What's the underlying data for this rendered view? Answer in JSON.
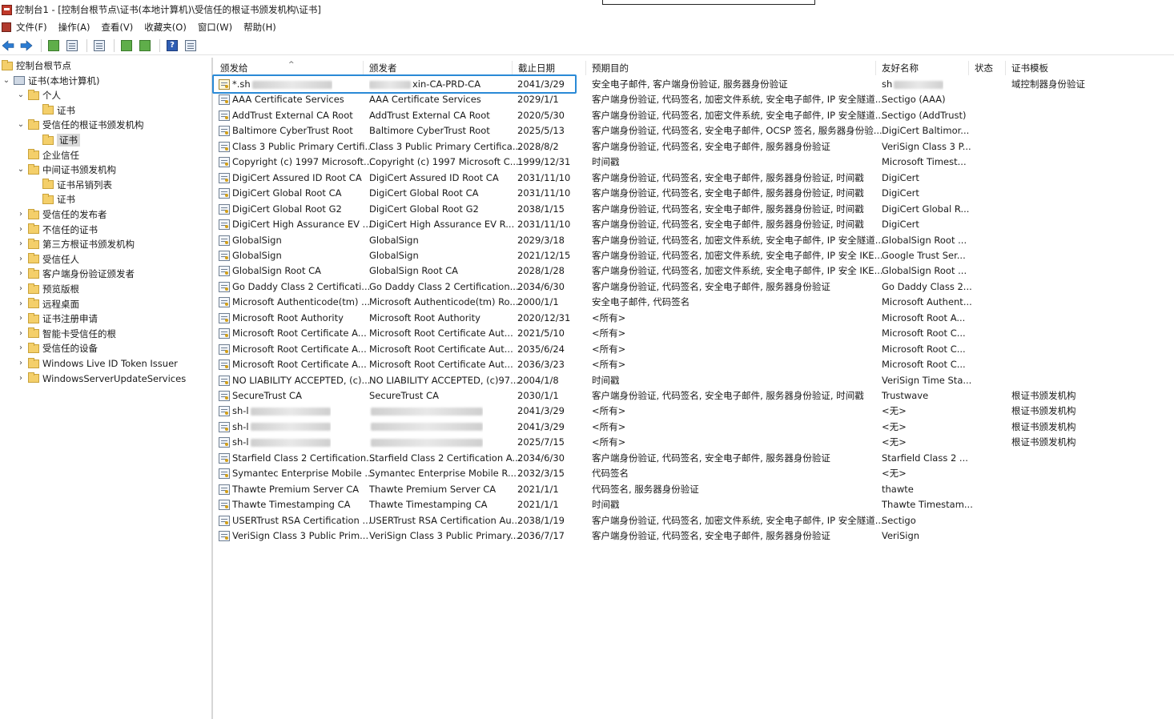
{
  "window": {
    "title": "控制台1 - [控制台根节点\\证书(本地计算机)\\受信任的根证书颁发机构\\证书]"
  },
  "menu": [
    "文件(F)",
    "操作(A)",
    "查看(V)",
    "收藏夹(O)",
    "窗口(W)",
    "帮助(H)"
  ],
  "toolbar": {
    "icons": [
      "back-icon",
      "forward-icon",
      "up-folder-icon",
      "show-tree-icon",
      "clipboard-icon",
      "refresh-icon",
      "export-icon",
      "help-icon",
      "properties-icon"
    ]
  },
  "tree": [
    {
      "label": "控制台根节点",
      "level": 0,
      "icon": "folder",
      "arrow": ""
    },
    {
      "label": "证书(本地计算机)",
      "level": 0,
      "icon": "pc",
      "arrow": "⌄"
    },
    {
      "label": "个人",
      "level": 1,
      "icon": "folder",
      "arrow": "⌄"
    },
    {
      "label": "证书",
      "level": 2,
      "icon": "folder",
      "arrow": ""
    },
    {
      "label": "受信任的根证书颁发机构",
      "level": 1,
      "icon": "folder",
      "arrow": "⌄"
    },
    {
      "label": "证书",
      "level": 2,
      "icon": "folder",
      "arrow": "",
      "selected": true
    },
    {
      "label": "企业信任",
      "level": 1,
      "icon": "folder",
      "arrow": ""
    },
    {
      "label": "中间证书颁发机构",
      "level": 1,
      "icon": "folder",
      "arrow": "⌄"
    },
    {
      "label": "证书吊销列表",
      "level": 2,
      "icon": "folder",
      "arrow": ""
    },
    {
      "label": "证书",
      "level": 2,
      "icon": "folder",
      "arrow": ""
    },
    {
      "label": "受信任的发布者",
      "level": 1,
      "icon": "folder",
      "arrow": "›"
    },
    {
      "label": "不信任的证书",
      "level": 1,
      "icon": "folder",
      "arrow": "›"
    },
    {
      "label": "第三方根证书颁发机构",
      "level": 1,
      "icon": "folder",
      "arrow": "›"
    },
    {
      "label": "受信任人",
      "level": 1,
      "icon": "folder",
      "arrow": "›"
    },
    {
      "label": "客户端身份验证颁发者",
      "level": 1,
      "icon": "folder",
      "arrow": "›"
    },
    {
      "label": "预览版根",
      "level": 1,
      "icon": "folder",
      "arrow": "›"
    },
    {
      "label": "远程桌面",
      "level": 1,
      "icon": "folder",
      "arrow": "›"
    },
    {
      "label": "证书注册申请",
      "level": 1,
      "icon": "folder",
      "arrow": "›"
    },
    {
      "label": "智能卡受信任的根",
      "level": 1,
      "icon": "folder",
      "arrow": "›"
    },
    {
      "label": "受信任的设备",
      "level": 1,
      "icon": "folder",
      "arrow": "›"
    },
    {
      "label": "Windows Live ID Token Issuer",
      "level": 1,
      "icon": "folder",
      "arrow": "›"
    },
    {
      "label": "WindowsServerUpdateServices",
      "level": 1,
      "icon": "folder",
      "arrow": "›"
    }
  ],
  "columns": [
    "颁发给",
    "颁发者",
    "截止日期",
    "预期目的",
    "友好名称",
    "状态",
    "证书模板"
  ],
  "rows": [
    {
      "to": "*.sh",
      "to_blur": true,
      "by": "xin-CA-PRD-CA",
      "by_blur_prefix": true,
      "date": "2041/3/29",
      "purpose": "安全电子邮件, 客户端身份验证, 服务器身份验证",
      "friendly": "sh",
      "friendly_blur": true,
      "status": "",
      "template": "域控制器身份验证",
      "key": true
    },
    {
      "to": "AAA Certificate Services",
      "by": "AAA Certificate Services",
      "date": "2029/1/1",
      "purpose": "客户端身份验证, 代码签名, 加密文件系统, 安全电子邮件, IP 安全隧道...",
      "friendly": "Sectigo (AAA)",
      "status": "",
      "template": ""
    },
    {
      "to": "AddTrust External CA Root",
      "by": "AddTrust External CA Root",
      "date": "2020/5/30",
      "purpose": "客户端身份验证, 代码签名, 加密文件系统, 安全电子邮件, IP 安全隧道...",
      "friendly": "Sectigo (AddTrust)",
      "status": "",
      "template": ""
    },
    {
      "to": "Baltimore CyberTrust Root",
      "by": "Baltimore CyberTrust Root",
      "date": "2025/5/13",
      "purpose": "客户端身份验证, 代码签名, 安全电子邮件, OCSP 签名, 服务器身份验...",
      "friendly": "DigiCert Baltimor...",
      "status": "",
      "template": ""
    },
    {
      "to": "Class 3 Public Primary Certifi...",
      "by": "Class 3 Public Primary Certifica...",
      "date": "2028/8/2",
      "purpose": "客户端身份验证, 代码签名, 安全电子邮件, 服务器身份验证",
      "friendly": "VeriSign Class 3 P...",
      "status": "",
      "template": ""
    },
    {
      "to": "Copyright (c) 1997 Microsoft...",
      "by": "Copyright (c) 1997 Microsoft C...",
      "date": "1999/12/31",
      "purpose": "时间戳",
      "friendly": "Microsoft Timest...",
      "status": "",
      "template": ""
    },
    {
      "to": "DigiCert Assured ID Root CA",
      "by": "DigiCert Assured ID Root CA",
      "date": "2031/11/10",
      "purpose": "客户端身份验证, 代码签名, 安全电子邮件, 服务器身份验证, 时间戳",
      "friendly": "DigiCert",
      "status": "",
      "template": ""
    },
    {
      "to": "DigiCert Global Root CA",
      "by": "DigiCert Global Root CA",
      "date": "2031/11/10",
      "purpose": "客户端身份验证, 代码签名, 安全电子邮件, 服务器身份验证, 时间戳",
      "friendly": "DigiCert",
      "status": "",
      "template": ""
    },
    {
      "to": "DigiCert Global Root G2",
      "by": "DigiCert Global Root G2",
      "date": "2038/1/15",
      "purpose": "客户端身份验证, 代码签名, 安全电子邮件, 服务器身份验证, 时间戳",
      "friendly": "DigiCert Global R...",
      "status": "",
      "template": ""
    },
    {
      "to": "DigiCert High Assurance EV ...",
      "by": "DigiCert High Assurance EV R...",
      "date": "2031/11/10",
      "purpose": "客户端身份验证, 代码签名, 安全电子邮件, 服务器身份验证, 时间戳",
      "friendly": "DigiCert",
      "status": "",
      "template": ""
    },
    {
      "to": "GlobalSign",
      "by": "GlobalSign",
      "date": "2029/3/18",
      "purpose": "客户端身份验证, 代码签名, 加密文件系统, 安全电子邮件, IP 安全隧道...",
      "friendly": "GlobalSign Root ...",
      "status": "",
      "template": ""
    },
    {
      "to": "GlobalSign",
      "by": "GlobalSign",
      "date": "2021/12/15",
      "purpose": "客户端身份验证, 代码签名, 加密文件系统, 安全电子邮件, IP 安全 IKE...",
      "friendly": "Google Trust Ser...",
      "status": "",
      "template": ""
    },
    {
      "to": "GlobalSign Root CA",
      "by": "GlobalSign Root CA",
      "date": "2028/1/28",
      "purpose": "客户端身份验证, 代码签名, 加密文件系统, 安全电子邮件, IP 安全 IKE...",
      "friendly": "GlobalSign Root ...",
      "status": "",
      "template": ""
    },
    {
      "to": "Go Daddy Class 2 Certificati...",
      "by": "Go Daddy Class 2 Certification...",
      "date": "2034/6/30",
      "purpose": "客户端身份验证, 代码签名, 安全电子邮件, 服务器身份验证",
      "friendly": "Go Daddy Class 2...",
      "status": "",
      "template": ""
    },
    {
      "to": "Microsoft Authenticode(tm) ...",
      "by": "Microsoft Authenticode(tm) Ro...",
      "date": "2000/1/1",
      "purpose": "安全电子邮件, 代码签名",
      "friendly": "Microsoft Authent...",
      "status": "",
      "template": ""
    },
    {
      "to": "Microsoft Root Authority",
      "by": "Microsoft Root Authority",
      "date": "2020/12/31",
      "purpose": "<所有>",
      "friendly": "Microsoft Root A...",
      "status": "",
      "template": ""
    },
    {
      "to": "Microsoft Root Certificate A...",
      "by": "Microsoft Root Certificate Aut...",
      "date": "2021/5/10",
      "purpose": "<所有>",
      "friendly": "Microsoft Root C...",
      "status": "",
      "template": ""
    },
    {
      "to": "Microsoft Root Certificate A...",
      "by": "Microsoft Root Certificate Aut...",
      "date": "2035/6/24",
      "purpose": "<所有>",
      "friendly": "Microsoft Root C...",
      "status": "",
      "template": ""
    },
    {
      "to": "Microsoft Root Certificate A...",
      "by": "Microsoft Root Certificate Aut...",
      "date": "2036/3/23",
      "purpose": "<所有>",
      "friendly": "Microsoft Root C...",
      "status": "",
      "template": ""
    },
    {
      "to": "NO LIABILITY ACCEPTED, (c)...",
      "by": "NO LIABILITY ACCEPTED, (c)97...",
      "date": "2004/1/8",
      "purpose": "时间戳",
      "friendly": "VeriSign Time Sta...",
      "status": "",
      "template": ""
    },
    {
      "to": "SecureTrust CA",
      "by": "SecureTrust CA",
      "date": "2030/1/1",
      "purpose": "客户端身份验证, 代码签名, 安全电子邮件, 服务器身份验证, 时间戳",
      "friendly": "Trustwave",
      "status": "",
      "template": "根证书颁发机构"
    },
    {
      "to": "sh-l",
      "to_blur": true,
      "by": "",
      "by_blur": true,
      "date": "2041/3/29",
      "purpose": "<所有>",
      "friendly": "<无>",
      "status": "",
      "template": "根证书颁发机构"
    },
    {
      "to": "sh-l",
      "to_blur": true,
      "by": "",
      "by_blur": true,
      "date": "2041/3/29",
      "purpose": "<所有>",
      "friendly": "<无>",
      "status": "",
      "template": "根证书颁发机构"
    },
    {
      "to": "sh-l",
      "to_blur": true,
      "by": "",
      "by_blur": true,
      "date": "2025/7/15",
      "purpose": "<所有>",
      "friendly": "<无>",
      "status": "",
      "template": "根证书颁发机构"
    },
    {
      "to": "Starfield Class 2 Certification...",
      "by": "Starfield Class 2 Certification A...",
      "date": "2034/6/30",
      "purpose": "客户端身份验证, 代码签名, 安全电子邮件, 服务器身份验证",
      "friendly": "Starfield Class 2 ...",
      "status": "",
      "template": ""
    },
    {
      "to": "Symantec Enterprise Mobile ...",
      "by": "Symantec Enterprise Mobile R...",
      "date": "2032/3/15",
      "purpose": "代码签名",
      "friendly": "<无>",
      "status": "",
      "template": ""
    },
    {
      "to": "Thawte Premium Server CA",
      "by": "Thawte Premium Server CA",
      "date": "2021/1/1",
      "purpose": "代码签名, 服务器身份验证",
      "friendly": "thawte",
      "status": "",
      "template": ""
    },
    {
      "to": "Thawte Timestamping CA",
      "by": "Thawte Timestamping CA",
      "date": "2021/1/1",
      "purpose": "时间戳",
      "friendly": "Thawte Timestam...",
      "status": "",
      "template": ""
    },
    {
      "to": "USERTrust RSA Certification ...",
      "by": "USERTrust RSA Certification Au...",
      "date": "2038/1/19",
      "purpose": "客户端身份验证, 代码签名, 加密文件系统, 安全电子邮件, IP 安全隧道...",
      "friendly": "Sectigo",
      "status": "",
      "template": ""
    },
    {
      "to": "VeriSign Class 3 Public Prim...",
      "by": "VeriSign Class 3 Public Primary...",
      "date": "2036/7/17",
      "purpose": "客户端身份验证, 代码签名, 安全电子邮件, 服务器身份验证",
      "friendly": "VeriSign",
      "status": "",
      "template": ""
    }
  ]
}
